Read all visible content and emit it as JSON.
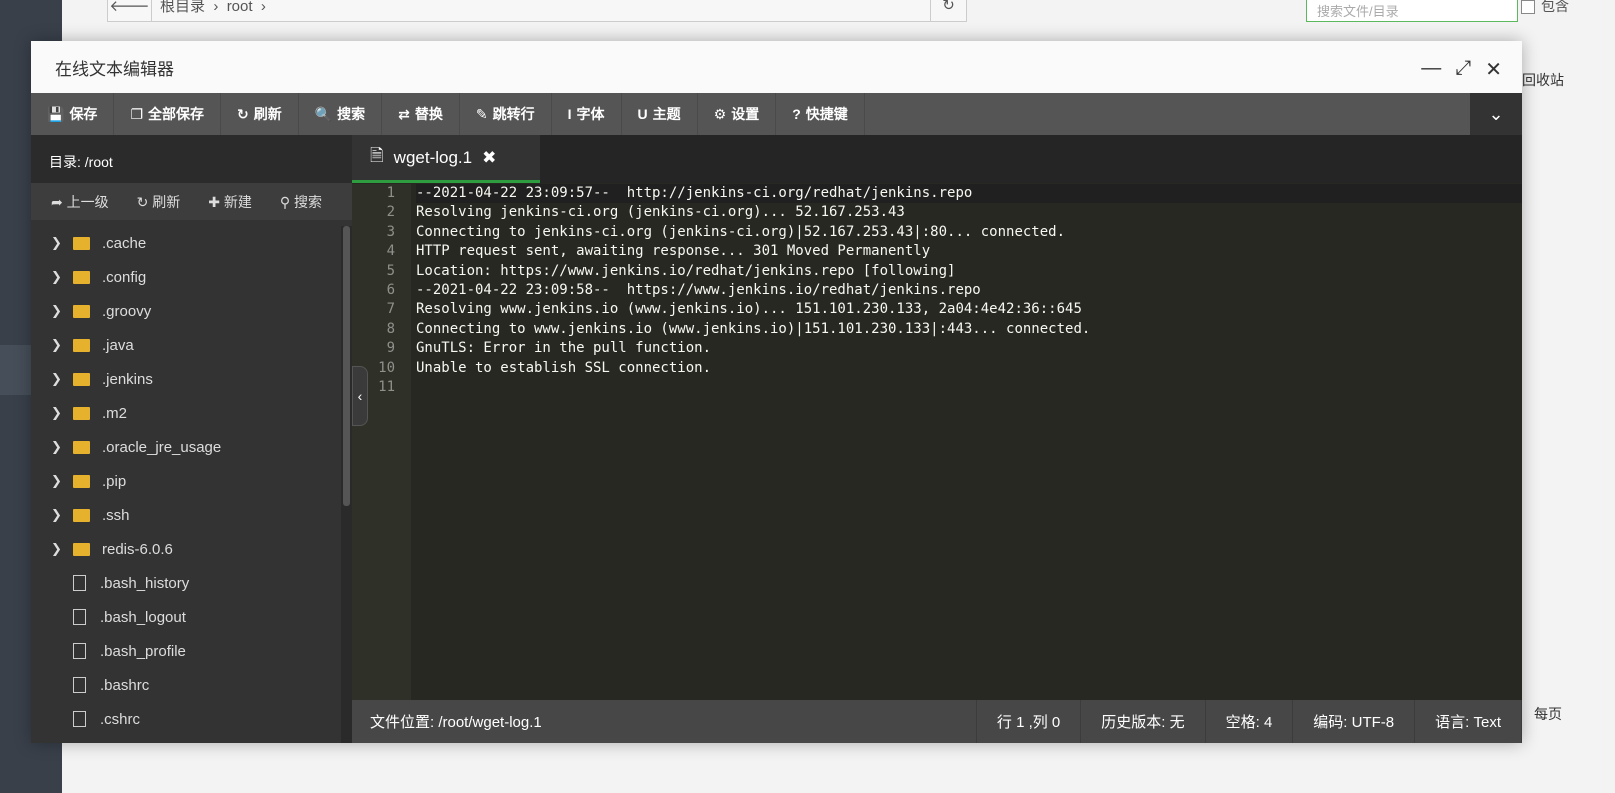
{
  "background": {
    "breadcrumb": [
      "根目录",
      "root"
    ],
    "search_placeholder": "搜索文件/目录",
    "include_label": "包含",
    "recycle": "回收站",
    "per_page": "每页"
  },
  "window": {
    "title": "在线文本编辑器"
  },
  "toolbar": [
    {
      "icon": "save-icon",
      "glyph": "💾",
      "label": "保存"
    },
    {
      "icon": "save-all-icon",
      "glyph": "❐",
      "label": "全部保存"
    },
    {
      "icon": "refresh-icon",
      "glyph": "↻",
      "label": "刷新"
    },
    {
      "icon": "search-icon",
      "glyph": "🔍",
      "label": "搜索"
    },
    {
      "icon": "replace-icon",
      "glyph": "⇄",
      "label": "替换"
    },
    {
      "icon": "pin-icon",
      "glyph": "✎",
      "label": "跳转行"
    },
    {
      "icon": "font-icon",
      "glyph": "I",
      "label": "字体"
    },
    {
      "icon": "theme-magnet-icon",
      "glyph": "U",
      "label": "主题"
    },
    {
      "icon": "gear-icon",
      "glyph": "⚙",
      "label": "设置"
    },
    {
      "icon": "question-icon",
      "glyph": "?",
      "label": "快捷键"
    }
  ],
  "sidebar": {
    "dir_label": "目录: /root",
    "actions": [
      {
        "icon": "up-icon",
        "glyph": "➦",
        "label": "上一级"
      },
      {
        "icon": "refresh-icon",
        "glyph": "↻",
        "label": "刷新"
      },
      {
        "icon": "plus-icon",
        "glyph": "✚",
        "label": "新建"
      },
      {
        "icon": "search-icon",
        "glyph": "⚲",
        "label": "搜索"
      }
    ],
    "folders": [
      ".cache",
      ".config",
      ".groovy",
      ".java",
      ".jenkins",
      ".m2",
      ".oracle_jre_usage",
      ".pip",
      ".ssh",
      "redis-6.0.6"
    ],
    "files": [
      ".bash_history",
      ".bash_logout",
      ".bash_profile",
      ".bashrc",
      ".cshrc"
    ]
  },
  "editor": {
    "tab": "wget-log.1",
    "lines": [
      "--2021-04-22 23:09:57--  http://jenkins-ci.org/redhat/jenkins.repo",
      "Resolving jenkins-ci.org (jenkins-ci.org)... 52.167.253.43",
      "Connecting to jenkins-ci.org (jenkins-ci.org)|52.167.253.43|:80... connected.",
      "HTTP request sent, awaiting response... 301 Moved Permanently",
      "Location: https://www.jenkins.io/redhat/jenkins.repo [following]",
      "--2021-04-22 23:09:58--  https://www.jenkins.io/redhat/jenkins.repo",
      "Resolving www.jenkins.io (www.jenkins.io)... 151.101.230.133, 2a04:4e42:36::645",
      "Connecting to www.jenkins.io (www.jenkins.io)|151.101.230.133|:443... connected.",
      "GnuTLS: Error in the pull function.",
      "Unable to establish SSL connection.",
      ""
    ]
  },
  "status": {
    "path": "文件位置: /root/wget-log.1",
    "cursor": "行 1 ,列 0",
    "history": "历史版本: 无",
    "indent": "空格: 4",
    "encoding": "编码: UTF-8",
    "language": "语言: Text"
  },
  "colors": {
    "accent": "#2e9d3f",
    "folder": "#e6b22e",
    "editor_bg": "#272822"
  }
}
